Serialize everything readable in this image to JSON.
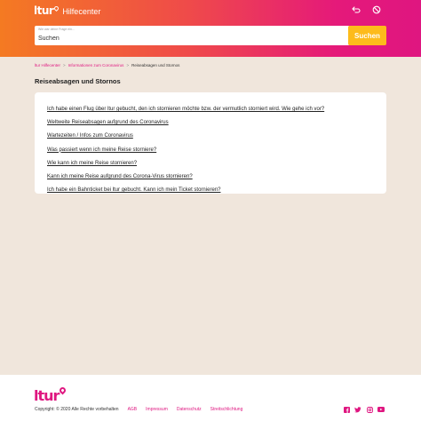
{
  "header": {
    "logo": "ltur",
    "subtitle": "Hilfecenter",
    "gradient": [
      "#f47a22",
      "#ef4a4a",
      "#e5197a",
      "#df1680"
    ],
    "icons": [
      "back-arrow-icon",
      "no-sign-icon"
    ]
  },
  "search": {
    "label": "Wie war deine Frage ein…",
    "value": "Suchen",
    "button": "Suchen",
    "button_color": "#fdbb1b"
  },
  "breadcrumb": {
    "items": [
      "ltur Hilfecenter",
      "Informationen zum Coronavirus"
    ],
    "separator": ">",
    "current": "Reiseabsagen und Stornos"
  },
  "page": {
    "title": "Reiseabsagen und Stornos"
  },
  "faq": [
    "Ich habe einen Flug über ltur gebucht, den ich stornieren möchte bzw. der vermutlich storniert wird. Wie gehe ich vor?",
    "Weltweite Reiseabsagen aufgrund des Coronavirus",
    "Wartezeiten / Infos zum Coronavirus",
    "Was passiert wenn ich meine Reise storniere?",
    "Wie kann ich meine Reise stornieren?",
    "Kann ich meine Reise aufgrund des Corona-Virus stornieren?",
    "Ich habe ein Bahnticket bei ltur gebucht. Kann ich mein Ticket stornieren?"
  ],
  "footer": {
    "logo": "ltur",
    "copyright": "Copyright: © 2020 Alle Rechte vorbehalten",
    "links": [
      "AGB",
      "Impressum",
      "Datenschutz",
      "Streitschlichtung"
    ],
    "social_icons": [
      "facebook-icon",
      "twitter-icon",
      "instagram-icon",
      "youtube-icon"
    ],
    "accent": "#df1680"
  }
}
